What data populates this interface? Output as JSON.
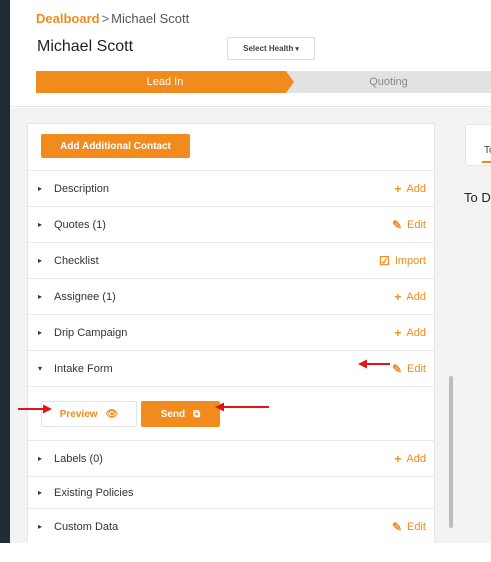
{
  "breadcrumb": {
    "root": "Dealboard",
    "separator": ">",
    "current": "Michael Scott"
  },
  "page_title": "Michael Scott",
  "health_select": {
    "label": "Select Health",
    "caret": "▾"
  },
  "pipeline": {
    "stages": [
      "Lead In",
      "Quoting"
    ],
    "active": "Lead In"
  },
  "add_contact_label": "Add Additional Contact",
  "sections": [
    {
      "title": "Description",
      "expanded": false,
      "action": "Add",
      "icon": "plus-icon",
      "glyph": "+"
    },
    {
      "title": "Quotes (1)",
      "expanded": false,
      "action": "Edit",
      "icon": "pencil-icon",
      "glyph": "✎"
    },
    {
      "title": "Checklist",
      "expanded": false,
      "action": "Import",
      "icon": "import-icon",
      "glyph": "☑"
    },
    {
      "title": "Assignee (1)",
      "expanded": false,
      "action": "Add",
      "icon": "plus-icon",
      "glyph": "+"
    },
    {
      "title": "Drip Campaign",
      "expanded": false,
      "action": "Add",
      "icon": "plus-icon",
      "glyph": "+"
    },
    {
      "title": "Intake Form",
      "expanded": true,
      "action": "Edit",
      "icon": "pencil-icon",
      "glyph": "✎"
    },
    {
      "title": "Labels (0)",
      "expanded": false,
      "action": "Add",
      "icon": "plus-icon",
      "glyph": "+"
    },
    {
      "title": "Existing Policies",
      "expanded": false,
      "action": "",
      "icon": "",
      "glyph": ""
    },
    {
      "title": "Custom Data",
      "expanded": false,
      "action": "Edit",
      "icon": "pencil-icon",
      "glyph": "✎"
    }
  ],
  "intake_form": {
    "preview_label": "Preview",
    "preview_icon": "eye-icon",
    "send_label": "Send",
    "send_icon": "external-link-icon"
  },
  "right_panel": {
    "tab_partial": "To",
    "heading_partial": "To D"
  },
  "glyphs": {
    "collapsed": "▸",
    "expanded": "▾",
    "eye": "👁",
    "external": "⧉"
  },
  "colors": {
    "accent": "#f28b1e",
    "annotation_arrow": "#e01616",
    "sidebar": "#1f2c33"
  }
}
